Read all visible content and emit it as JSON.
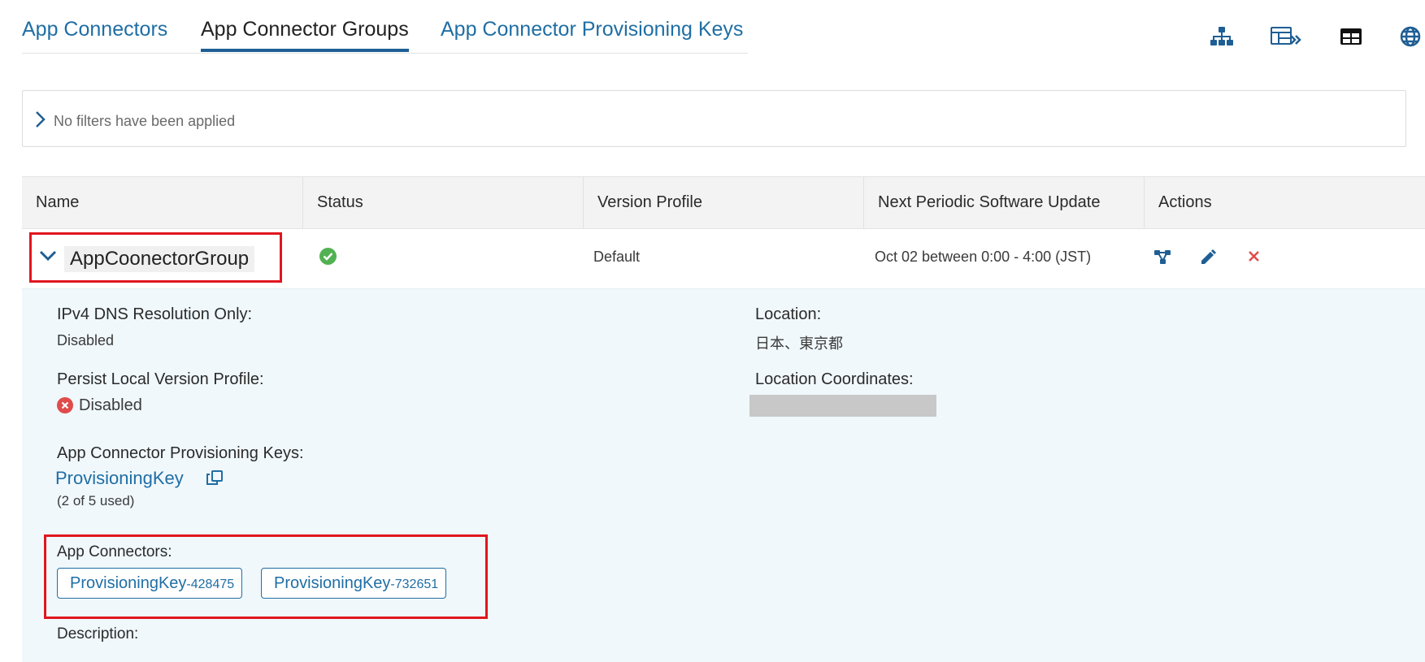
{
  "tabs": [
    {
      "label": "App Connectors",
      "active": false
    },
    {
      "label": "App Connector Groups",
      "active": true
    },
    {
      "label": "App Connector Provisioning Keys",
      "active": false
    }
  ],
  "toolbar": {
    "icons": [
      "hierarchy-icon",
      "table-forward-icon",
      "table-icon",
      "globe-icon"
    ]
  },
  "filters": {
    "text": "No filters have been applied"
  },
  "table": {
    "columns": [
      "Name",
      "Status",
      "Version Profile",
      "Next Periodic Software Update",
      "Actions"
    ],
    "row": {
      "name": "AppCoonectorGroup",
      "status": "enabled",
      "version_profile": "Default",
      "next_update": "Oct 02 between 0:00 - 4:00 (JST)"
    }
  },
  "details": {
    "ipv4_label": "IPv4 DNS Resolution Only:",
    "ipv4_value": "Disabled",
    "location_label": "Location:",
    "location_value": "日本、東京都",
    "persist_label": "Persist Local Version Profile:",
    "persist_value": "Disabled",
    "coords_label": "Location Coordinates:",
    "keys_label": "App Connector Provisioning Keys:",
    "key_name": "ProvisioningKey",
    "key_usage": "(2 of 5 used)",
    "connectors_label": "App Connectors:",
    "connectors": [
      {
        "name": "ProvisioningKey",
        "suffix": "-428475"
      },
      {
        "name": "ProvisioningKey",
        "suffix": "-732651"
      }
    ],
    "description_label": "Description:"
  },
  "colors": {
    "link": "#1f6ea4",
    "highlight": "#e0161e",
    "status_ok": "#52b152",
    "status_error": "#e04b4b",
    "panel_bg": "#f0f8fc"
  }
}
